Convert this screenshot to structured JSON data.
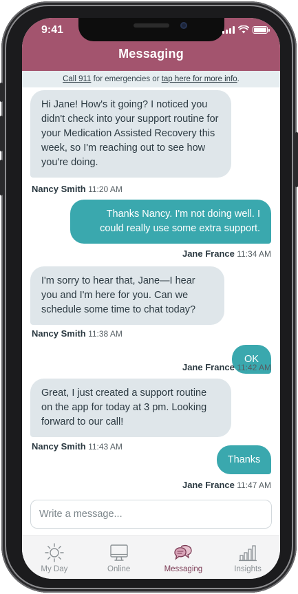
{
  "status_bar": {
    "time": "9:41"
  },
  "header": {
    "title": "Messaging"
  },
  "emergency": {
    "call_link": "Call 911",
    "text_mid": " for emergencies or ",
    "info_link": "tap here for more info",
    "text_end": "."
  },
  "messages": [
    {
      "direction": "in",
      "text": "Hi Jane! How's it going? I noticed you didn't check into your support routine for your Medication Assisted Recovery this week, so I'm reaching out to see how you're doing.",
      "sender": "Nancy Smith",
      "time": "11:20 AM"
    },
    {
      "direction": "out",
      "text": "Thanks Nancy. I'm not doing well. I could really use some extra support.",
      "sender": "Jane France",
      "time": "11:34 AM"
    },
    {
      "direction": "in",
      "text": "I'm sorry to hear that, Jane—I hear you and I'm here for you. Can we schedule some time to chat today?",
      "sender": "Nancy Smith",
      "time": "11:38 AM"
    },
    {
      "direction": "out",
      "text": "OK",
      "sender": "Jane France",
      "time": "11:42 AM"
    },
    {
      "direction": "in",
      "text": "Great, I just created a support routine on the app for today at 3 pm. Looking forward to our call!",
      "sender": "Nancy Smith",
      "time": "11:43 AM"
    },
    {
      "direction": "out",
      "text": "Thanks",
      "sender": "Jane France",
      "time": "11:47 AM"
    }
  ],
  "composer": {
    "placeholder": "Write a message..."
  },
  "tabs": [
    {
      "label": "My Day",
      "icon": "sun-icon",
      "active": false
    },
    {
      "label": "Online",
      "icon": "monitor-icon",
      "active": false
    },
    {
      "label": "Messaging",
      "icon": "chat-bubbles-icon",
      "active": true
    },
    {
      "label": "Insights",
      "icon": "bar-chart-icon",
      "active": false
    }
  ],
  "colors": {
    "header": "#a3546e",
    "incoming_bubble": "#dfe6ea",
    "outgoing_bubble": "#3aa8ae",
    "active_tab": "#7a3953",
    "inactive_tab": "#8a9094"
  }
}
